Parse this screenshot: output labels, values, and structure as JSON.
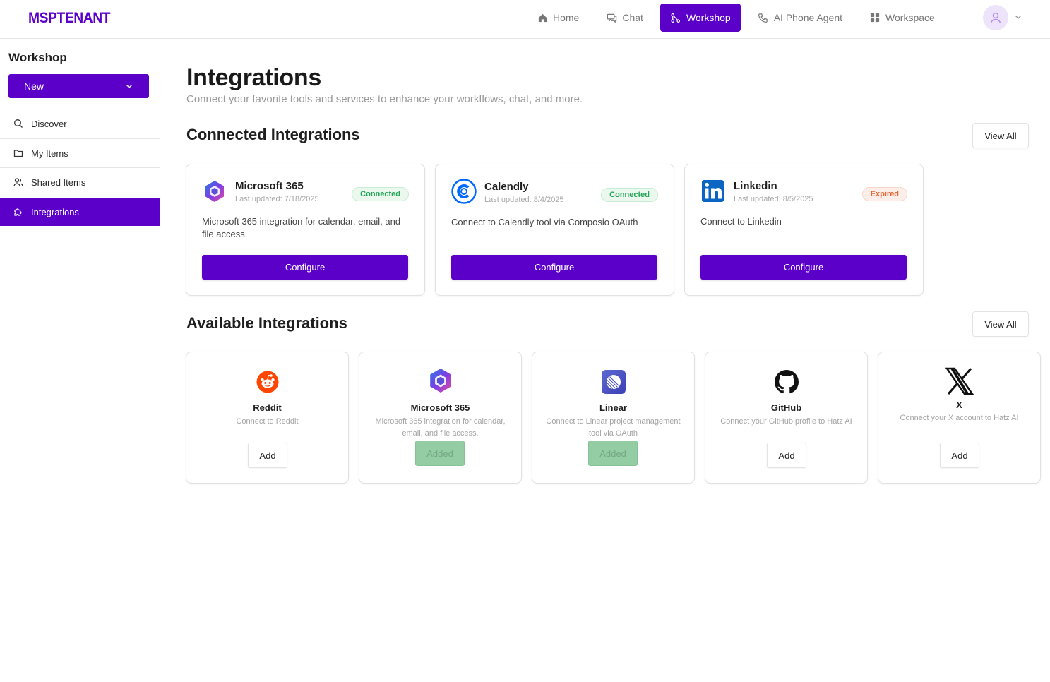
{
  "header": {
    "logo": "MSPTENANT",
    "nav": [
      {
        "label": "Home",
        "icon": "home-icon"
      },
      {
        "label": "Chat",
        "icon": "chat-icon"
      },
      {
        "label": "Workshop",
        "icon": "workflow-icon",
        "active": true
      },
      {
        "label": "AI Phone Agent",
        "icon": "phone-icon"
      },
      {
        "label": "Workspace",
        "icon": "grid-icon"
      }
    ]
  },
  "sidebar": {
    "title": "Workshop",
    "new_button": "New",
    "items": [
      {
        "label": "Discover",
        "icon": "search-icon"
      },
      {
        "label": "My Items",
        "icon": "folder-icon"
      },
      {
        "label": "Shared Items",
        "icon": "users-icon"
      },
      {
        "label": "Integrations",
        "icon": "puzzle-icon",
        "active": true
      }
    ]
  },
  "main": {
    "title": "Integrations",
    "subtitle": "Connect your favorite tools and services to enhance your workflows, chat, and more.",
    "connected": {
      "title": "Connected Integrations",
      "view_all": "View All",
      "cards": [
        {
          "name": "Microsoft 365",
          "updated": "Last updated: 7/18/2025",
          "status": "Connected",
          "desc": "Microsoft 365 integration for calendar, email, and file access.",
          "button": "Configure"
        },
        {
          "name": "Calendly",
          "updated": "Last updated: 8/4/2025",
          "status": "Connected",
          "desc": "Connect to Calendly tool via Composio OAuth",
          "button": "Configure"
        },
        {
          "name": "Linkedin",
          "updated": "Last updated: 8/5/2025",
          "status": "Expired",
          "desc": "Connect to Linkedin",
          "button": "Configure"
        }
      ]
    },
    "available": {
      "title": "Available Integrations",
      "view_all": "View All",
      "cards": [
        {
          "name": "Reddit",
          "desc": "Connect to Reddit",
          "button": "Add"
        },
        {
          "name": "Microsoft 365",
          "desc": "Microsoft 365 integration for calendar, email, and file access.",
          "button": "Added"
        },
        {
          "name": "Linear",
          "desc": "Connect to Linear project management tool via OAuth",
          "button": "Added"
        },
        {
          "name": "GitHub",
          "desc": "Connect your GitHub profile to Hatz AI",
          "button": "Add"
        },
        {
          "name": "X",
          "desc": "Connect your X account to Hatz AI",
          "button": "Add"
        }
      ]
    }
  },
  "colors": {
    "brand": "#5b00c8",
    "connected": "#23a455",
    "expired": "#e5632e",
    "added": "#94cca3"
  }
}
